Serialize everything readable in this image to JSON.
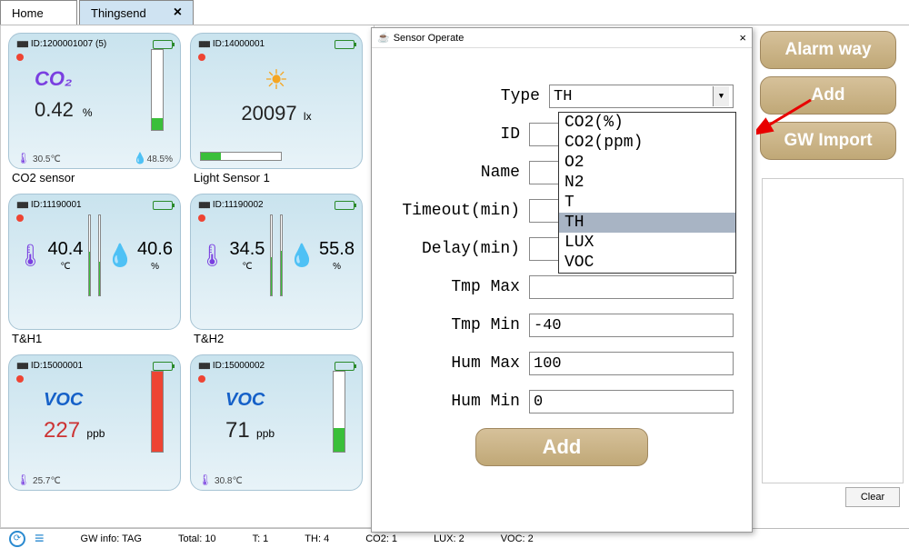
{
  "tabs": {
    "home": "Home",
    "thingsend": "Thingsend"
  },
  "cards": [
    {
      "id": "ID:1200001007 (5)",
      "name": "CO2 sensor",
      "kind": "co2",
      "label": "CO₂",
      "value": "0.42",
      "unit": "%",
      "foot_l": "30.5℃",
      "foot_r": "48.5%"
    },
    {
      "id": "ID:14000001",
      "name": "Light Sensor 1",
      "kind": "lux",
      "value": "20097",
      "unit": "lx"
    },
    {
      "id": "ID:11190001",
      "name": "T&H1",
      "kind": "th",
      "t": "40.4",
      "t_u": "℃",
      "h": "40.6",
      "h_u": "%"
    },
    {
      "id": "ID:11190002",
      "name": "T&H2",
      "kind": "th",
      "t": "34.5",
      "t_u": "℃",
      "h": "55.8",
      "h_u": "%"
    },
    {
      "id": "ID:15000001",
      "name": "",
      "kind": "voc",
      "label": "VOC",
      "value": "227",
      "unit": "ppb",
      "foot_l": "25.7℃"
    },
    {
      "id": "ID:15000002",
      "name": "",
      "kind": "voc",
      "label": "VOC",
      "value": "71",
      "unit": "ppb",
      "foot_l": "30.8℃"
    }
  ],
  "dialog": {
    "title": "Sensor Operate",
    "labels": {
      "type": "Type",
      "id": "ID",
      "name": "Name",
      "timeout": "Timeout(min)",
      "delay": "Delay(min)",
      "tmax": "Tmp Max",
      "tmin": "Tmp Min",
      "hmax": "Hum Max",
      "hmin": "Hum Min"
    },
    "type_value": "TH",
    "options": [
      "CO2(%)",
      "CO2(ppm)",
      "O2",
      "N2",
      "T",
      "TH",
      "LUX",
      "VOC"
    ],
    "selected_option": "TH",
    "tmin": "-40",
    "hmax": "100",
    "hmin": "0",
    "add": "Add"
  },
  "rpanel": {
    "alarm": "Alarm way",
    "add": "Add",
    "gw": "GW Import",
    "clear": "Clear"
  },
  "status": {
    "gw": "GW info: TAG",
    "total": "Total: 10",
    "t": "T: 1",
    "th": "TH: 4",
    "co2": "CO2: 1",
    "lux": "LUX: 2",
    "voc": "VOC: 2"
  }
}
